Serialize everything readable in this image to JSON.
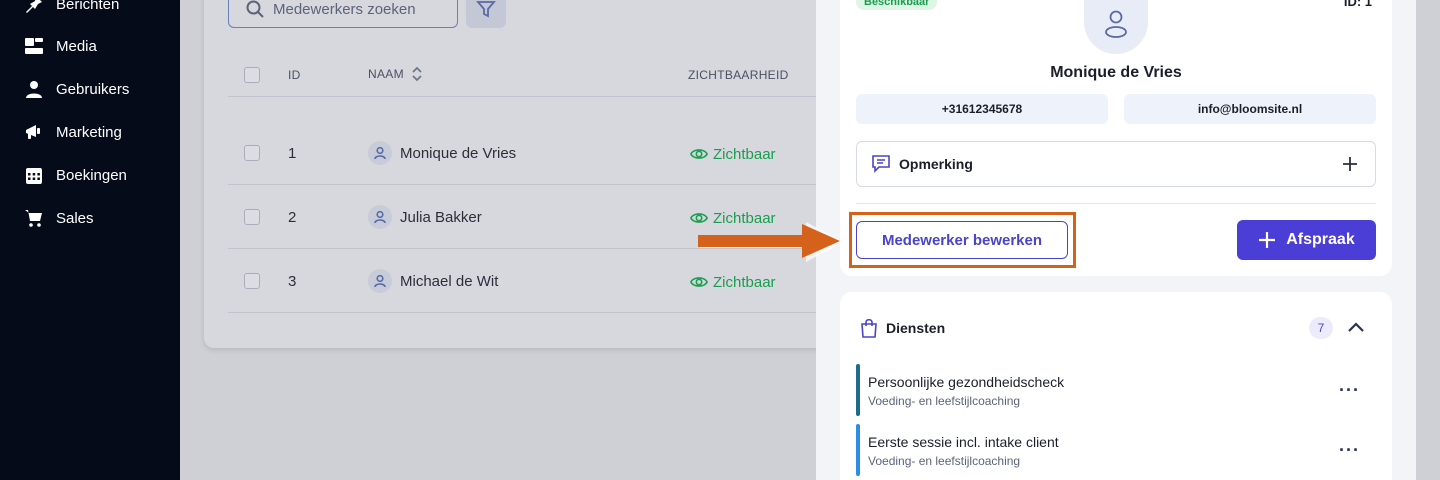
{
  "sidebar": {
    "items": [
      {
        "label": "Berichten",
        "icon": "pin-icon"
      },
      {
        "label": "Media",
        "icon": "media-icon"
      },
      {
        "label": "Gebruikers",
        "icon": "user-icon"
      },
      {
        "label": "Marketing",
        "icon": "megaphone-icon"
      },
      {
        "label": "Boekingen",
        "icon": "calendar-icon"
      },
      {
        "label": "Sales",
        "icon": "cart-icon"
      }
    ]
  },
  "toolbar": {
    "search_placeholder": "Medewerkers zoeken"
  },
  "table": {
    "headers": {
      "id": "ID",
      "name": "NAAM",
      "visibility": "ZICHTBAARHEID"
    },
    "rows": [
      {
        "id": "1",
        "name": "Monique de Vries",
        "visibility": "Zichtbaar"
      },
      {
        "id": "2",
        "name": "Julia Bakker",
        "visibility": "Zichtbaar"
      },
      {
        "id": "3",
        "name": "Michael de Wit",
        "visibility": "Zichtbaar"
      }
    ]
  },
  "panel": {
    "status_badge": "Beschikbaar",
    "id_label": "ID: 1",
    "name": "Monique de Vries",
    "phone": "+31612345678",
    "email": "info@bloomsite.nl",
    "note_label": "Opmerking",
    "edit_label": "Medewerker bewerken",
    "appointment_label": "Afspraak",
    "services": {
      "title": "Diensten",
      "count": "7",
      "items": [
        {
          "title": "Persoonlijke gezondheidscheck",
          "subtitle": "Voeding- en leefstijlcoaching",
          "color": "#1b6e8a"
        },
        {
          "title": "Eerste sessie incl. intake client",
          "subtitle": "Voeding- en leefstijlcoaching",
          "color": "#2b8ee0"
        }
      ]
    }
  },
  "colors": {
    "primary": "#4a3ed6",
    "success": "#1a9e4e",
    "highlight": "#d4621a",
    "sidebar": "#060b1a"
  }
}
